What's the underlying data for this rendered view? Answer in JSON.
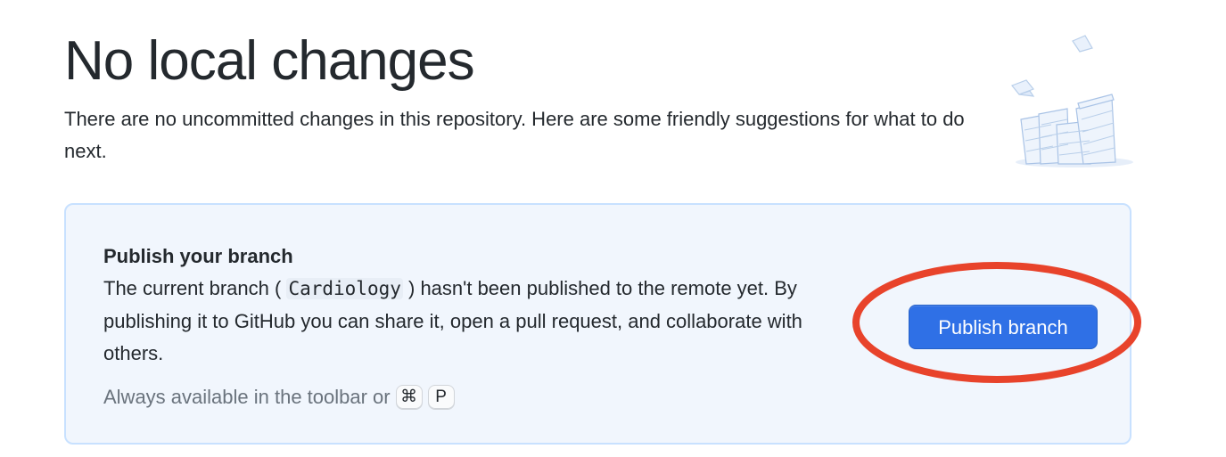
{
  "header": {
    "title": "No local changes",
    "subtitle": "There are no uncommitted changes in this repository. Here are some friendly suggestions for what to do next."
  },
  "illustration": {
    "icon": "paper-stack-illustration-icon"
  },
  "publish_card": {
    "title": "Publish your branch",
    "desc_before": "The current branch (",
    "branch_name": "Cardiology",
    "desc_after": ") hasn't been published to the remote yet. By publishing it to GitHub you can share it, open a pull request, and collaborate with others.",
    "hint": "Always available in the toolbar or",
    "shortcut_key_1": "⌘",
    "shortcut_key_2": "P",
    "button_label": "Publish branch"
  },
  "colors": {
    "card_background": "#f1f6fd",
    "card_border": "#c8e1ff",
    "button": "#2f70e6",
    "annotation_ring": "#e8432b"
  }
}
